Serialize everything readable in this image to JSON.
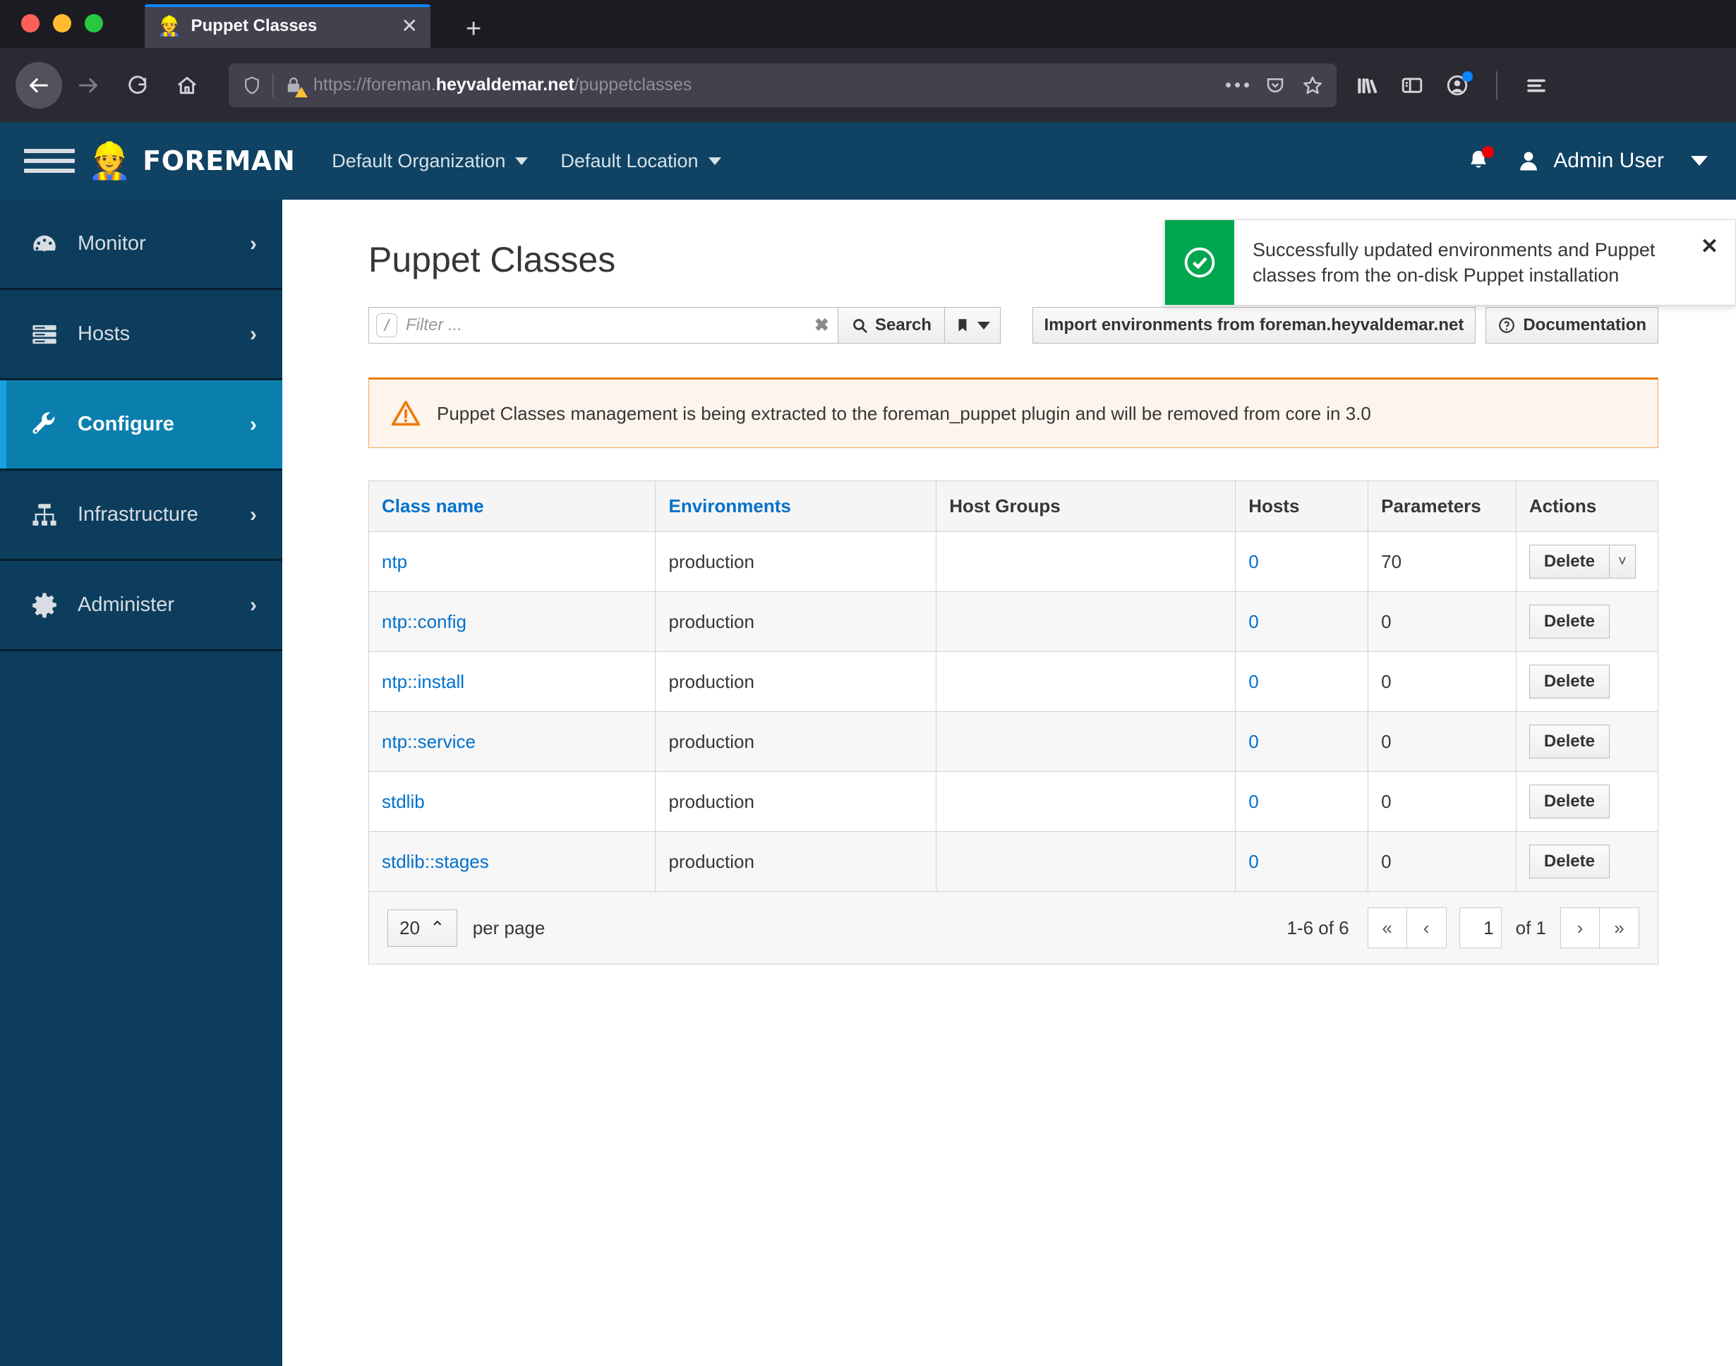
{
  "browser": {
    "tab": {
      "title": "Puppet Classes",
      "favicon": "hardhat-icon",
      "close": "✕"
    },
    "new_tab_label": "+",
    "url": {
      "prefix": "https://foreman.",
      "domain": "heyvaldemar.net",
      "path": "/puppetclasses"
    },
    "nav": {
      "back": "back-icon",
      "forward": "forward-icon",
      "reload": "reload-icon",
      "home": "home-icon"
    },
    "url_icons": [
      "ellipsis-icon",
      "pocket-icon",
      "bookmark-star-icon"
    ],
    "toolbar_icons": [
      "library-icon",
      "sidebar-icon",
      "account-icon",
      "app-menu-icon"
    ]
  },
  "header": {
    "menu_toggle": "hamburger-icon",
    "brand": "FOREMAN",
    "brand_logo": "hardhat-icon",
    "organization": "Default Organization",
    "location": "Default Location",
    "user_name": "Admin User",
    "bell": "bell-icon",
    "accent_blue": "#0d82ad",
    "navy": "#0f4263"
  },
  "sidebar": {
    "items": [
      {
        "label": "Monitor",
        "icon": "dashboard-icon",
        "active": false
      },
      {
        "label": "Hosts",
        "icon": "server-icon",
        "active": false
      },
      {
        "label": "Configure",
        "icon": "wrench-icon",
        "active": true
      },
      {
        "label": "Infrastructure",
        "icon": "sitemap-icon",
        "active": false
      },
      {
        "label": "Administer",
        "icon": "gear-icon",
        "active": false
      }
    ],
    "chevron": "›"
  },
  "main": {
    "page_title": "Puppet Classes",
    "search": {
      "slash_hint": "/",
      "placeholder": "Filter ...",
      "value": "",
      "clear": "✖",
      "search_label": "Search",
      "bookmark_icon": "bookmark-icon"
    },
    "buttons": {
      "import": "Import environments from foreman.heyvaldemar.net",
      "documentation": "Documentation"
    },
    "alert": {
      "icon": "warning-triangle-icon",
      "text": "Puppet Classes management is being extracted to the foreman_puppet plugin and will be removed from core in 3.0",
      "border_color": "#ec7a08",
      "background": "#fdf4ec"
    },
    "table": {
      "columns": [
        {
          "label": "Class name",
          "link": true
        },
        {
          "label": "Environments",
          "link": true
        },
        {
          "label": "Host Groups",
          "link": false
        },
        {
          "label": "Hosts",
          "link": false
        },
        {
          "label": "Parameters",
          "link": false
        },
        {
          "label": "Actions",
          "link": false
        }
      ],
      "rows": [
        {
          "class_name": "ntp",
          "environments": "production",
          "host_groups": "",
          "hosts": "0",
          "parameters": "70",
          "action": "Delete",
          "has_caret": true
        },
        {
          "class_name": "ntp::config",
          "environments": "production",
          "host_groups": "",
          "hosts": "0",
          "parameters": "0",
          "action": "Delete",
          "has_caret": false
        },
        {
          "class_name": "ntp::install",
          "environments": "production",
          "host_groups": "",
          "hosts": "0",
          "parameters": "0",
          "action": "Delete",
          "has_caret": false
        },
        {
          "class_name": "ntp::service",
          "environments": "production",
          "host_groups": "",
          "hosts": "0",
          "parameters": "0",
          "action": "Delete",
          "has_caret": false
        },
        {
          "class_name": "stdlib",
          "environments": "production",
          "host_groups": "",
          "hosts": "0",
          "parameters": "0",
          "action": "Delete",
          "has_caret": false
        },
        {
          "class_name": "stdlib::stages",
          "environments": "production",
          "host_groups": "",
          "hosts": "0",
          "parameters": "0",
          "action": "Delete",
          "has_caret": false
        }
      ]
    },
    "pagination": {
      "per_page_value": "20",
      "per_page_caret": "⌃",
      "per_page_label": "per page",
      "range": "1-6 of  6",
      "first": "«",
      "prev": "‹",
      "page_value": "1",
      "of_label": "of  1",
      "next": "›",
      "last": "»"
    }
  },
  "toast": {
    "icon": "check-circle-icon",
    "message": "Successfully updated environments and Puppet classes from the on-disk Puppet installation",
    "close": "✕",
    "color": "#00a64f"
  }
}
